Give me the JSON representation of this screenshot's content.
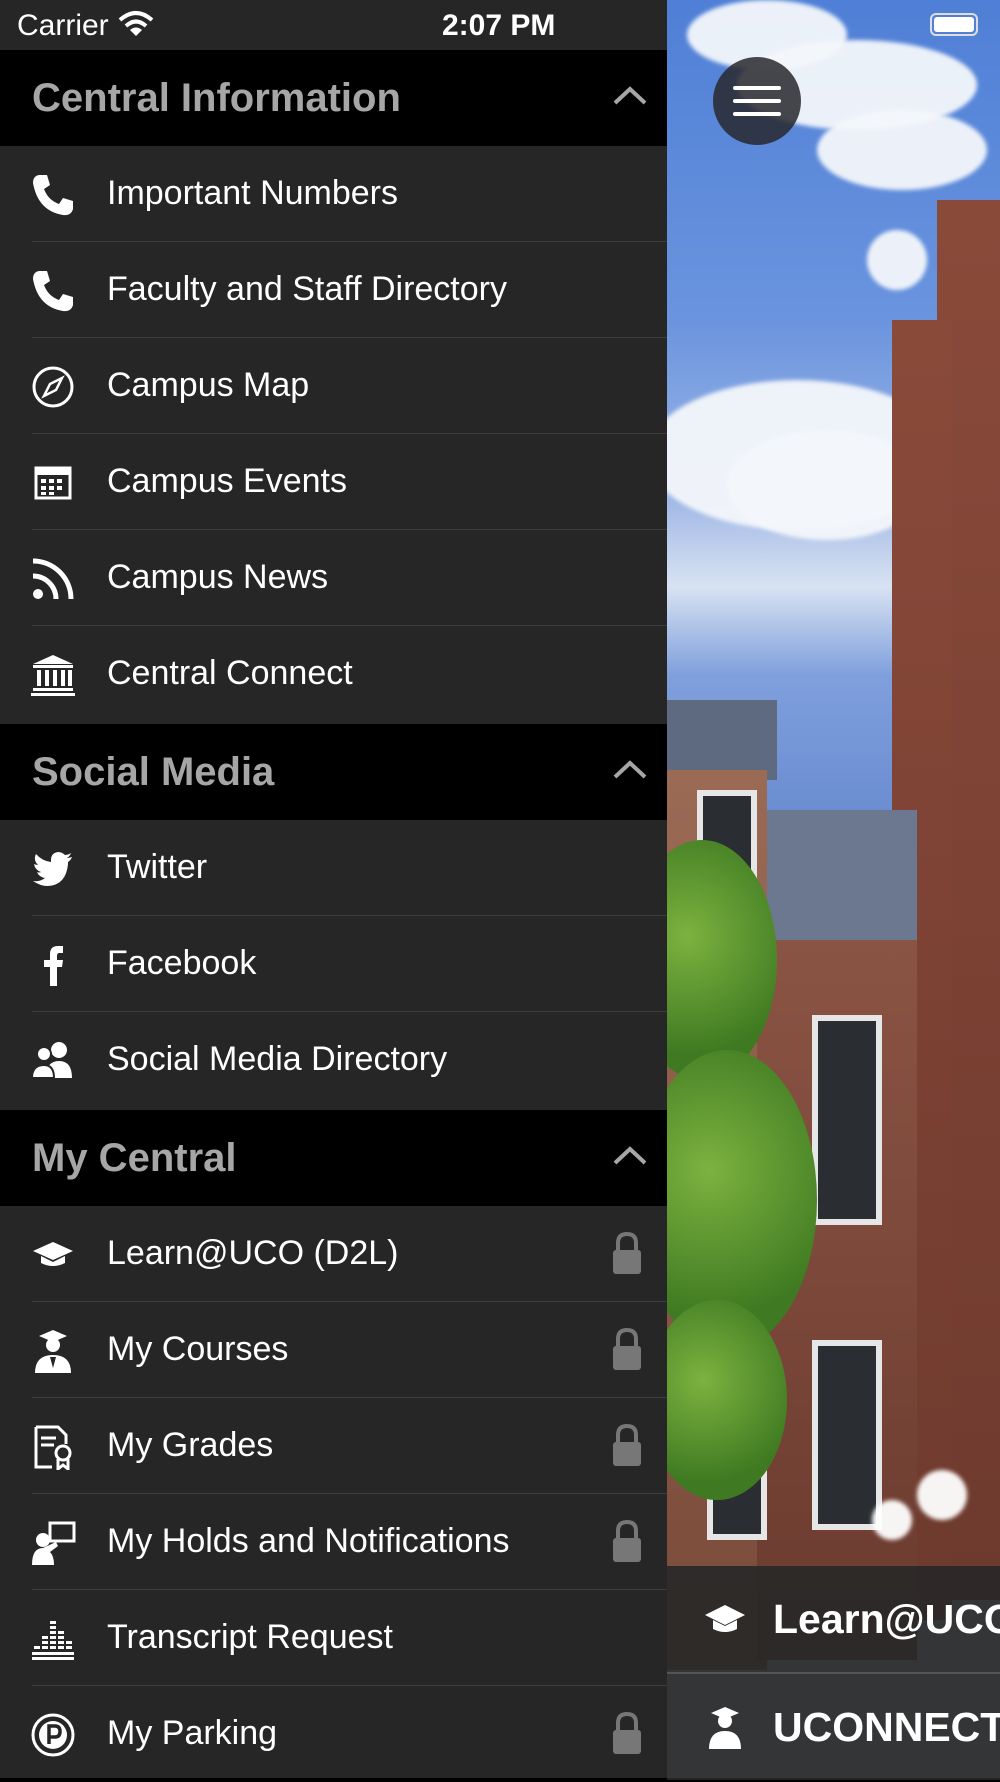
{
  "status_bar": {
    "carrier": "Carrier",
    "time": "2:07 PM"
  },
  "sections": [
    {
      "title": "Central Information",
      "items": [
        {
          "label": "Important Numbers",
          "icon": "phone-icon"
        },
        {
          "label": "Faculty and Staff Directory",
          "icon": "phone-icon"
        },
        {
          "label": "Campus Map",
          "icon": "compass-icon"
        },
        {
          "label": "Campus Events",
          "icon": "calendar-icon"
        },
        {
          "label": "Campus News",
          "icon": "rss-icon"
        },
        {
          "label": "Central Connect",
          "icon": "bank-icon"
        }
      ]
    },
    {
      "title": "Social Media",
      "items": [
        {
          "label": "Twitter",
          "icon": "twitter-icon"
        },
        {
          "label": "Facebook",
          "icon": "facebook-icon"
        },
        {
          "label": "Social Media Directory",
          "icon": "users-icon"
        }
      ]
    },
    {
      "title": "My Central",
      "items": [
        {
          "label": "Learn@UCO (D2L)",
          "icon": "graduation-cap-icon",
          "locked": true
        },
        {
          "label": "My Courses",
          "icon": "graduate-icon",
          "locked": true
        },
        {
          "label": "My Grades",
          "icon": "certificate-icon",
          "locked": true
        },
        {
          "label": "My Holds and Notifications",
          "icon": "presenter-icon",
          "locked": true
        },
        {
          "label": "Transcript Request",
          "icon": "bars-icon",
          "locked": false
        },
        {
          "label": "My Parking",
          "icon": "parking-icon",
          "locked": true
        }
      ]
    }
  ],
  "quick_links": {
    "learn": "Learn@UCO",
    "uconnect": "UCONNECT"
  }
}
